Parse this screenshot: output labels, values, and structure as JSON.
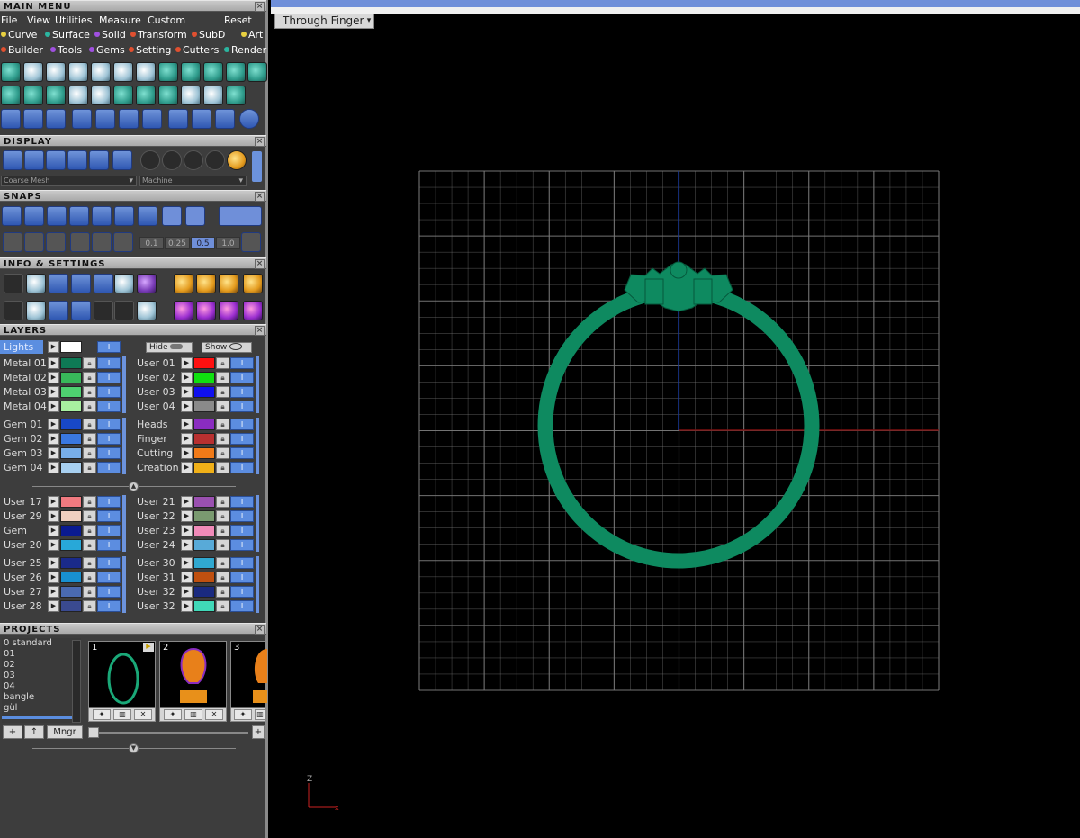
{
  "main_menu": {
    "title": "MAIN MENU",
    "menus": [
      "File",
      "View",
      "Utilities",
      "Measure",
      "Custom"
    ],
    "reset": "Reset",
    "categories_row1": [
      {
        "label": "Curve",
        "color": "#e8d040"
      },
      {
        "label": "Surface",
        "color": "#2bb5a0"
      },
      {
        "label": "Solid",
        "color": "#a050e0"
      },
      {
        "label": "Transform",
        "color": "#e05030"
      },
      {
        "label": "SubD",
        "color": "#e05030"
      },
      {
        "label": "Art",
        "color": "#e8d040"
      }
    ],
    "categories_row2": [
      {
        "label": "Builder",
        "color": "#e05030"
      },
      {
        "label": "Tools",
        "color": "#a050e0"
      },
      {
        "label": "Gems",
        "color": "#a050e0"
      },
      {
        "label": "Setting",
        "color": "#e05030"
      },
      {
        "label": "Cutters",
        "color": "#e05030"
      },
      {
        "label": "Render",
        "color": "#2bb5a0"
      }
    ]
  },
  "display": {
    "title": "DISPLAY",
    "mesh_dropdown": "Coarse Mesh",
    "render_dropdown": "Machine"
  },
  "snaps": {
    "title": "SNAPS",
    "values": [
      "0.1",
      "0.25",
      "0.5",
      "1.0"
    ],
    "selected": "0.5"
  },
  "info": {
    "title": "INFO & SETTINGS"
  },
  "layers": {
    "title": "LAYERS",
    "lights": "Lights",
    "hide": "Hide",
    "show": "Show",
    "group1_left": [
      {
        "name": "Metal 01",
        "color": "#0e7a55"
      },
      {
        "name": "Metal 02",
        "color": "#38b85a"
      },
      {
        "name": "Metal 03",
        "color": "#4ed070"
      },
      {
        "name": "Metal 04",
        "color": "#a8f0a0"
      }
    ],
    "group1_right": [
      {
        "name": "User 01",
        "color": "#ff1010"
      },
      {
        "name": "User 02",
        "color": "#10e010"
      },
      {
        "name": "User 03",
        "color": "#1010ee"
      },
      {
        "name": "User 04",
        "color": "#8a8a8a"
      }
    ],
    "group2_left": [
      {
        "name": "Gem 01",
        "color": "#1848c8"
      },
      {
        "name": "Gem 02",
        "color": "#3a78e0"
      },
      {
        "name": "Gem 03",
        "color": "#78aee8"
      },
      {
        "name": "Gem 04",
        "color": "#a8d0f0"
      }
    ],
    "group2_right": [
      {
        "name": "Heads",
        "color": "#8a2cc0"
      },
      {
        "name": "Finger",
        "color": "#b83030"
      },
      {
        "name": "Cutting",
        "color": "#f07a18"
      },
      {
        "name": "Creation",
        "color": "#f0b018"
      }
    ],
    "group3_left": [
      {
        "name": "User 17",
        "color": "#f07a80"
      },
      {
        "name": "User 29",
        "color": "#f0d0c0"
      },
      {
        "name": "Gem",
        "color": "#0a1a90"
      },
      {
        "name": "User 20",
        "color": "#28a8d8"
      }
    ],
    "group3_right": [
      {
        "name": "User 21",
        "color": "#9a50b0"
      },
      {
        "name": "User 22",
        "color": "#7a9a70"
      },
      {
        "name": "User 23",
        "color": "#f08ab8"
      },
      {
        "name": "User 24",
        "color": "#58aad8"
      }
    ],
    "group4_left": [
      {
        "name": "User 25",
        "color": "#1a2a8a"
      },
      {
        "name": "User 26",
        "color": "#1890d0"
      },
      {
        "name": "User 27",
        "color": "#4a6ab0"
      },
      {
        "name": "User 28",
        "color": "#3a4a90"
      }
    ],
    "group4_right": [
      {
        "name": "User 30",
        "color": "#30a8d0"
      },
      {
        "name": "User 31",
        "color": "#c05010"
      },
      {
        "name": "User 32",
        "color": "#1a2a80"
      },
      {
        "name": "User 32",
        "color": "#40d8b8"
      }
    ]
  },
  "projects": {
    "title": "PROJECTS",
    "list": [
      "0 standard",
      "01",
      "02",
      "03",
      "04",
      "bangle",
      "gül"
    ],
    "thumbs": [
      "1",
      "2",
      "3"
    ],
    "manager": "Mngr"
  },
  "viewport": {
    "view_name": "Through Finger",
    "axis_label": "Z",
    "ring_color": "#0e8a60",
    "grid_color": "#7a7a7a",
    "axis_x_color": "#7a1010",
    "axis_y_color": "#1a3a9a"
  },
  "icons": {
    "close": "close-icon",
    "lock": "lock-icon",
    "arrow": "arrow-right-icon"
  }
}
